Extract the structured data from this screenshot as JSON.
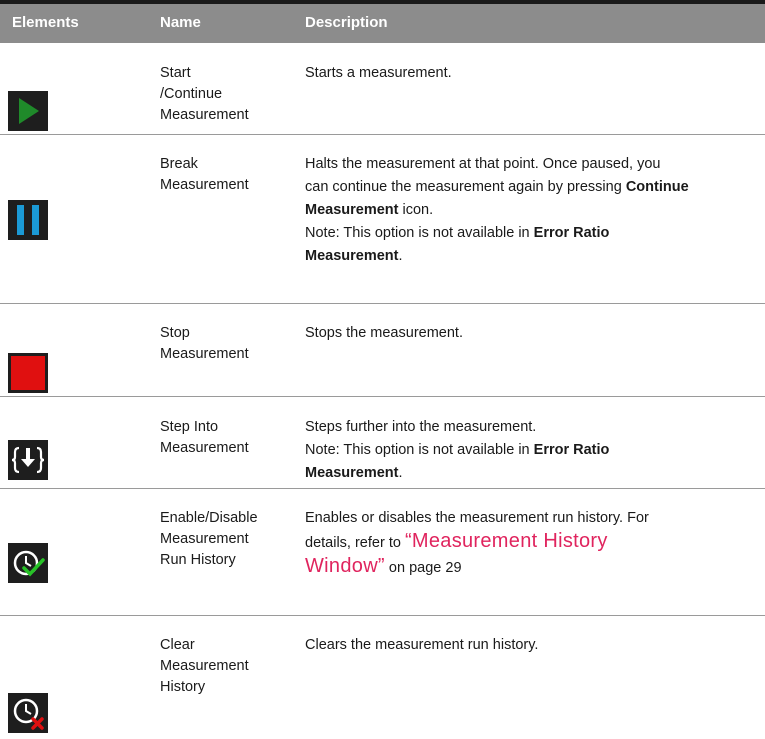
{
  "header": {
    "col_elements": "Elements",
    "col_name": "Name",
    "col_description": "Description"
  },
  "rows": [
    {
      "name_lines": [
        "Start",
        "/Continue",
        "Measurement"
      ],
      "description": "Starts a measurement.",
      "icon": "play-icon",
      "icon_color": "#1f8a2a"
    },
    {
      "name_lines": [
        "Break",
        "Measurement"
      ],
      "desc_line1": "Halts the measurement at that point. Once paused, you",
      "desc_line2_prefix": "can continue the measurement again by pressing ",
      "desc_line2_bold": "Continue",
      "desc_line3_bold": "Measurement",
      "desc_line3_suffix": " icon.",
      "note_prefix": "Note: This option is not available in ",
      "note_bold1": "Error Ratio",
      "note_bold2": "Measurement",
      "note_suffix": ".",
      "icon": "pause-icon",
      "icon_color": "#1b9ad6"
    },
    {
      "name_lines": [
        "Stop",
        "Measurement"
      ],
      "description": "Stops the measurement.",
      "icon": "stop-icon",
      "icon_color": "#e01010"
    },
    {
      "name_lines": [
        "Step Into",
        "Measurement"
      ],
      "desc_line1": "Steps further into the measurement.",
      "note_prefix": "Note: This option is not available in ",
      "note_bold1": "Error Ratio",
      "note_bold2": "Measurement",
      "note_suffix": ".",
      "icon": "step-into-icon"
    },
    {
      "name_lines": [
        "Enable/Disable",
        "Measurement",
        "Run History"
      ],
      "desc_line1": "Enables or disables the measurement run history. For",
      "desc_line2_prefix": "details, refer to ",
      "link_line1": "“Measurement History",
      "link_line2": "Window”",
      "page_ref": " on page 29",
      "icon": "history-enable-icon",
      "icon_accent": "#27c227"
    },
    {
      "name_lines": [
        "Clear",
        "Measurement",
        "History"
      ],
      "description": "Clears the measurement run history.",
      "icon": "history-clear-icon",
      "icon_accent": "#e01010"
    }
  ]
}
